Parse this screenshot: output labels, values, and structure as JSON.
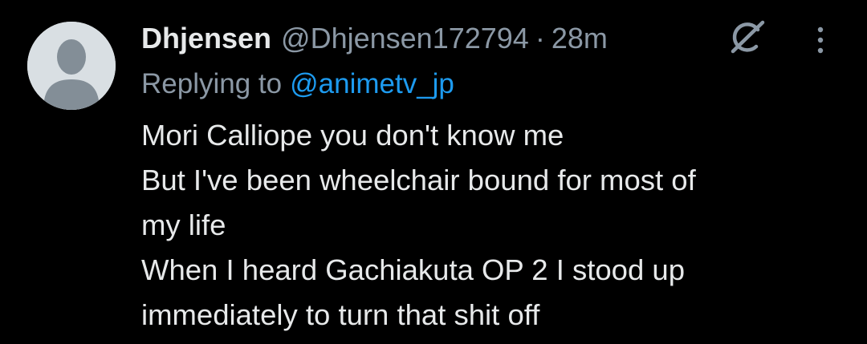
{
  "tweet": {
    "display_name": "Dhjensen",
    "handle": "@Dhjensen172794",
    "separator": "·",
    "time": "28m",
    "replying_prefix": "Replying to",
    "replying_to": "@animetv_jp",
    "lines": [
      "Mori Calliope you don't know me",
      "But I've been wheelchair bound for most of",
      "my life",
      "When I heard Gachiakuta OP 2 I stood up",
      "immediately to turn that shit off"
    ]
  },
  "icons": {
    "avatar": "default-avatar-icon",
    "grok": "grok-icon",
    "more": "more-vertical-icon"
  },
  "colors": {
    "background": "#000000",
    "primary_text": "#e7e9ea",
    "secondary_text": "#8b98a5",
    "link": "#1d9bf0",
    "avatar_bg": "#d9dfe3",
    "avatar_figure": "#838e97"
  }
}
